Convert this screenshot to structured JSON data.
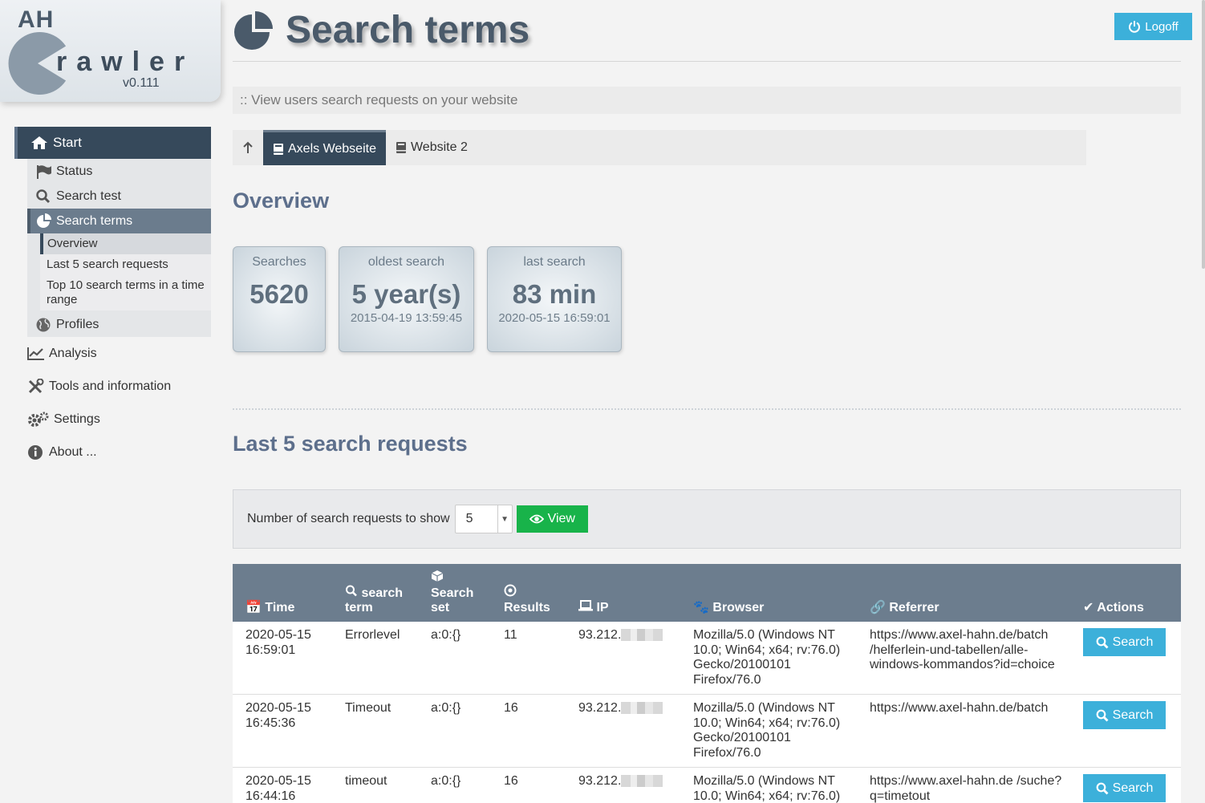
{
  "logo": {
    "ah": "AH",
    "crawler": "rawler",
    "version": "v0.111"
  },
  "nav": {
    "start": "Start",
    "sub": [
      {
        "label": "Status",
        "icon": "flag-icon"
      },
      {
        "label": "Search test",
        "icon": "search-icon"
      },
      {
        "label": "Search terms",
        "icon": "pie-chart-icon"
      }
    ],
    "subsub": [
      "Overview",
      "Last 5 search requests",
      "Top 10 search terms in a time range"
    ],
    "profiles": "Profiles",
    "top": [
      {
        "label": "Analysis",
        "icon": "chart-line-icon"
      },
      {
        "label": "Tools and information",
        "icon": "tools-icon"
      },
      {
        "label": "Settings",
        "icon": "gears-icon"
      },
      {
        "label": "About ...",
        "icon": "info-icon"
      }
    ]
  },
  "header": {
    "title": "Search terms",
    "logoff": "Logoff",
    "subtitle": ":: View users search requests on your website"
  },
  "tabs": [
    "Axels Webseite",
    "Website 2"
  ],
  "overview": {
    "heading": "Overview",
    "tiles": [
      {
        "label": "Searches",
        "value": "5620",
        "sub": ""
      },
      {
        "label": "oldest search",
        "value": "5 year(s)",
        "sub": "2015-04-19 13:59:45"
      },
      {
        "label": "last search",
        "value": "83 min",
        "sub": "2020-05-15 16:59:01"
      }
    ]
  },
  "last": {
    "heading_pre": "Last ",
    "heading_num": "5",
    "heading_post": " search requests",
    "form_label": "Number of search requests to show",
    "select_value": "5",
    "view_button": "View"
  },
  "table": {
    "headers": [
      "Time",
      "search term",
      "Search set",
      "Results",
      "IP",
      "Browser",
      "Referrer",
      "Actions"
    ],
    "rows": [
      {
        "time": "2020-05-15 16:59:01",
        "term": "Errorlevel",
        "set": "a:0:{}",
        "results": "11",
        "ip": "93.212.",
        "browser": "Mozilla/5.0 (Windows NT 10.0; Win64; x64; rv:76.0) Gecko/20100101 Firefox/76.0",
        "referrer": "https://www.axel-hahn.de/batch /helferlein-und-tabellen/alle-windows-kommandos?id=choice",
        "action": "Search"
      },
      {
        "time": "2020-05-15 16:45:36",
        "term": "Timeout",
        "set": "a:0:{}",
        "results": "16",
        "ip": "93.212.",
        "browser": "Mozilla/5.0 (Windows NT 10.0; Win64; x64; rv:76.0) Gecko/20100101 Firefox/76.0",
        "referrer": "https://www.axel-hahn.de/batch",
        "action": "Search"
      },
      {
        "time": "2020-05-15 16:44:16",
        "term": "timeout",
        "set": "a:0:{}",
        "results": "16",
        "ip": "93.212.",
        "browser": "Mozilla/5.0 (Windows NT 10.0; Win64; x64; rv:76.0)",
        "referrer": "https://www.axel-hahn.de /suche?q=timetout",
        "action": "Search"
      }
    ]
  },
  "colors": {
    "nav_dark": "#36495b",
    "accent_blue": "#3cb0da",
    "green": "#18b34a",
    "table_header": "#6c7d8e"
  }
}
